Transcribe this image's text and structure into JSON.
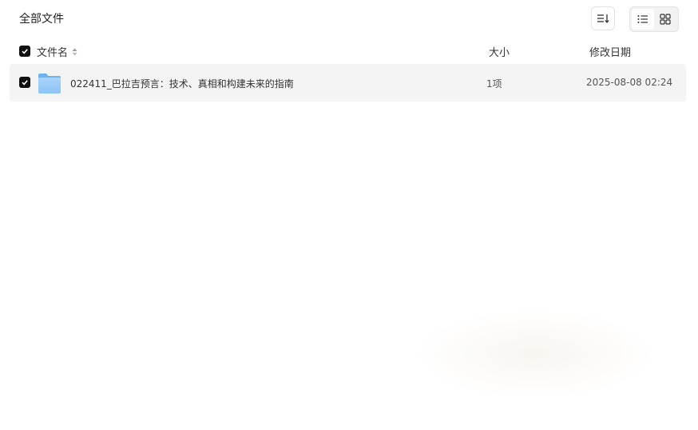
{
  "breadcrumb": {
    "title": "全部文件"
  },
  "toolbar": {
    "sort_icon": "sort-icon",
    "list_view_icon": "list-view-icon",
    "grid_view_icon": "grid-view-icon",
    "active_view": "list"
  },
  "table": {
    "columns": {
      "name": "文件名",
      "size": "大小",
      "date": "修改日期"
    },
    "rows": [
      {
        "name": "022411_巴拉吉预言：技术、真相和构建未来的指南",
        "size": "1项",
        "date": "2025-08-08 02:24",
        "type_icon": "folder-icon",
        "selected": true
      }
    ]
  },
  "colors": {
    "checkbox": "#111111",
    "row_highlight": "#f4f4f4",
    "folder_light": "#b8dcff",
    "folder_dark": "#7cbcf5"
  }
}
